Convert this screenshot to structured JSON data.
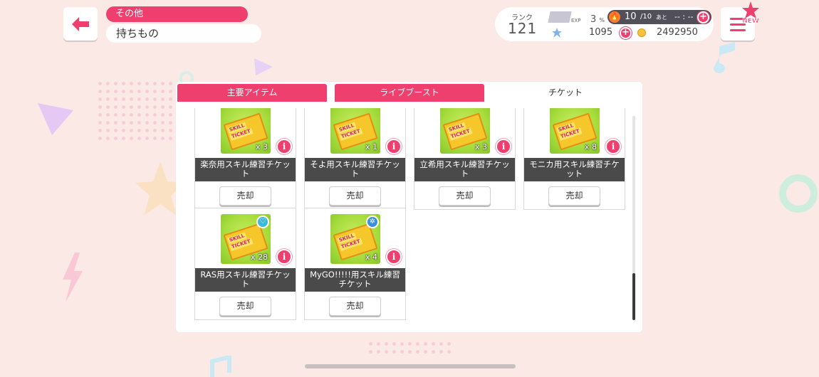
{
  "header": {
    "category": "その他",
    "title": "持ちもの"
  },
  "status": {
    "rank_label": "ランク",
    "rank_value": "121",
    "exp_label": "EXP",
    "exp_percent": "3",
    "exp_unit": "%",
    "life_value": "10",
    "life_max": "/10",
    "life_ato": "あと",
    "life_time": "-- : --",
    "stars": "1095",
    "coins": "2492950"
  },
  "menu": {
    "new_badge": "NEW"
  },
  "tabs": [
    {
      "label": "主要アイテム",
      "active": false
    },
    {
      "label": "ライブブースト",
      "active": false
    },
    {
      "label": "チケット",
      "active": true
    }
  ],
  "ticket_image_text": [
    "SKILL",
    "TICKET"
  ],
  "items": [
    {
      "name": "楽奈用スキル練習チケット",
      "count": "x 3",
      "sell": "売却"
    },
    {
      "name": "そよ用スキル練習チケット",
      "count": "x 1",
      "sell": "売却"
    },
    {
      "name": "立希用スキル練習チケット",
      "count": "x 3",
      "sell": "売却"
    },
    {
      "name": "モニカ用スキル練習チケット",
      "count": "x 8",
      "sell": "売却"
    },
    {
      "name": "RAS用スキル練習チケット",
      "count": "x 28",
      "sell": "売却"
    },
    {
      "name": "MyGO!!!!!用スキル練習チケット",
      "count": "x 4",
      "sell": "売却"
    }
  ],
  "info_glyph": "i",
  "colors": {
    "accent": "#ee3f6e",
    "band_ras": "#3fb8d8",
    "band_mygo": "#3a8fd8"
  }
}
